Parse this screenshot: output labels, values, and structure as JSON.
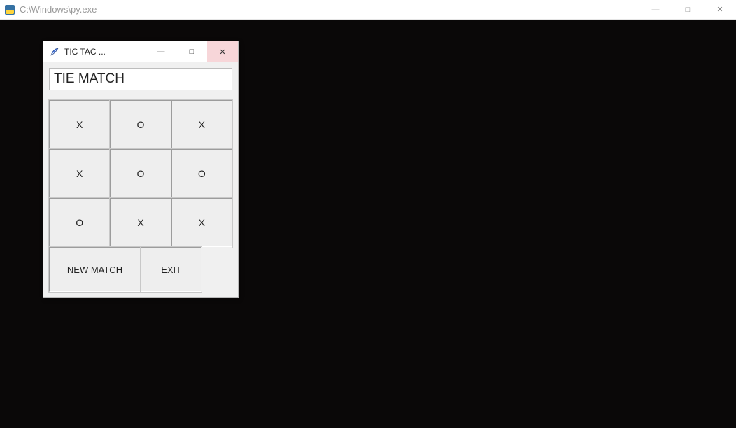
{
  "outer_window": {
    "title": "C:\\Windows\\py.exe",
    "controls": {
      "minimize": "—",
      "maximize": "□",
      "close": "✕"
    }
  },
  "inner_window": {
    "title": "TIC TAC ...",
    "controls": {
      "minimize": "—",
      "maximize": "□",
      "close": "✕"
    }
  },
  "game": {
    "status_text": "TIE MATCH",
    "board": [
      [
        "X",
        "O",
        "X"
      ],
      [
        "X",
        "O",
        "O"
      ],
      [
        "O",
        "X",
        "X"
      ]
    ],
    "buttons": {
      "new_match": "NEW MATCH",
      "exit": "EXIT"
    }
  }
}
